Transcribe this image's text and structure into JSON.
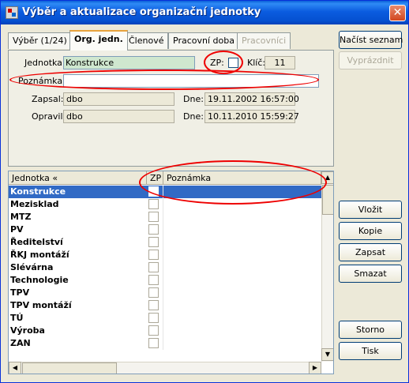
{
  "window": {
    "title": "Výběr a aktualizace organizační jednotky",
    "close_glyph": "✕"
  },
  "tabs": [
    {
      "label": "Výběr (1/24)"
    },
    {
      "label": "Org. jedn."
    },
    {
      "label": "Členové"
    },
    {
      "label": "Pracovní doba"
    },
    {
      "label": "Pracovníci"
    }
  ],
  "form": {
    "jednotka_label": "Jednotka:",
    "jednotka_value": "Konstrukce",
    "zp_label": "ZP:",
    "klic_label": "Klíč:",
    "klic_value": "11",
    "poznamka_label": "Poznámka:",
    "poznamka_value": "",
    "zapsal_label": "Zapsal:",
    "zapsal_value": "dbo",
    "dne1_label": "Dne:",
    "dne1_value": "19.11.2002 16:57:00",
    "opravil_label": "Opravil:",
    "opravil_value": "dbo",
    "dne2_label": "Dne:",
    "dne2_value": "10.11.2010 15:59:27"
  },
  "grid": {
    "col_jednotka": "Jednotka «",
    "col_zp": "ZP",
    "col_poznamka": "Poznámka",
    "rows": [
      "Konstrukce",
      "Mezisklad",
      "MTZ",
      "PV",
      "Ředitelství",
      "ŘKJ montáží",
      "Slévárna",
      "Technologie",
      "TPV",
      "TPV montáží",
      "TÚ",
      "Výroba",
      "ZAN"
    ]
  },
  "buttons": {
    "nacist": "Načíst seznam",
    "vyprazdnit": "Vyprázdnit",
    "vlozit": "Vložit",
    "kopie": "Kopie",
    "zapsat": "Zapsat",
    "smazat": "Smazat",
    "storno": "Storno",
    "tisk": "Tisk"
  },
  "colors": {
    "annotation": "#e00000",
    "selection": "#316ac5",
    "title_bar": "#0550d0"
  }
}
